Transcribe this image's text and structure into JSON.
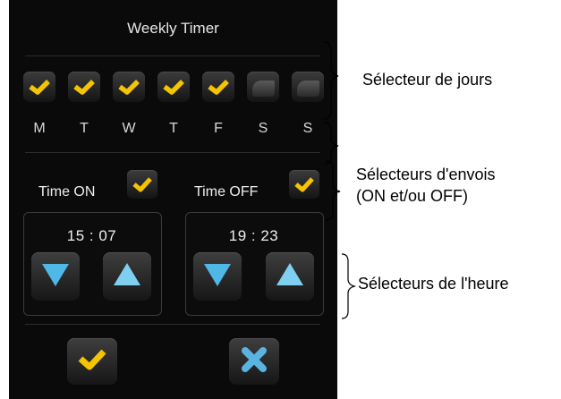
{
  "panel": {
    "title": "Weekly Timer",
    "days": [
      {
        "label": "M",
        "checked": true
      },
      {
        "label": "T",
        "checked": true
      },
      {
        "label": "W",
        "checked": true
      },
      {
        "label": "T",
        "checked": true
      },
      {
        "label": "F",
        "checked": true
      },
      {
        "label": "S",
        "checked": false
      },
      {
        "label": "S",
        "checked": false
      }
    ],
    "time_on": {
      "label": "Time ON",
      "value": "15 : 07",
      "checked": true
    },
    "time_off": {
      "label": "Time OFF",
      "value": "19 : 23",
      "checked": true
    },
    "icons": {
      "check": "checkmark-icon",
      "down": "arrow-down-icon",
      "up": "arrow-up-icon",
      "cancel": "cross-icon"
    }
  },
  "annotations": {
    "days": "Sélecteur de jours",
    "send_line1": "Sélecteurs d'envois",
    "send_line2": "(ON et/ou OFF)",
    "hours": "Sélecteurs de l'heure"
  },
  "colors": {
    "check": "#f5c400",
    "arrow": "#4fb8e6",
    "cross": "#5ab4e0",
    "panel_bg": "#0a0a0a"
  }
}
